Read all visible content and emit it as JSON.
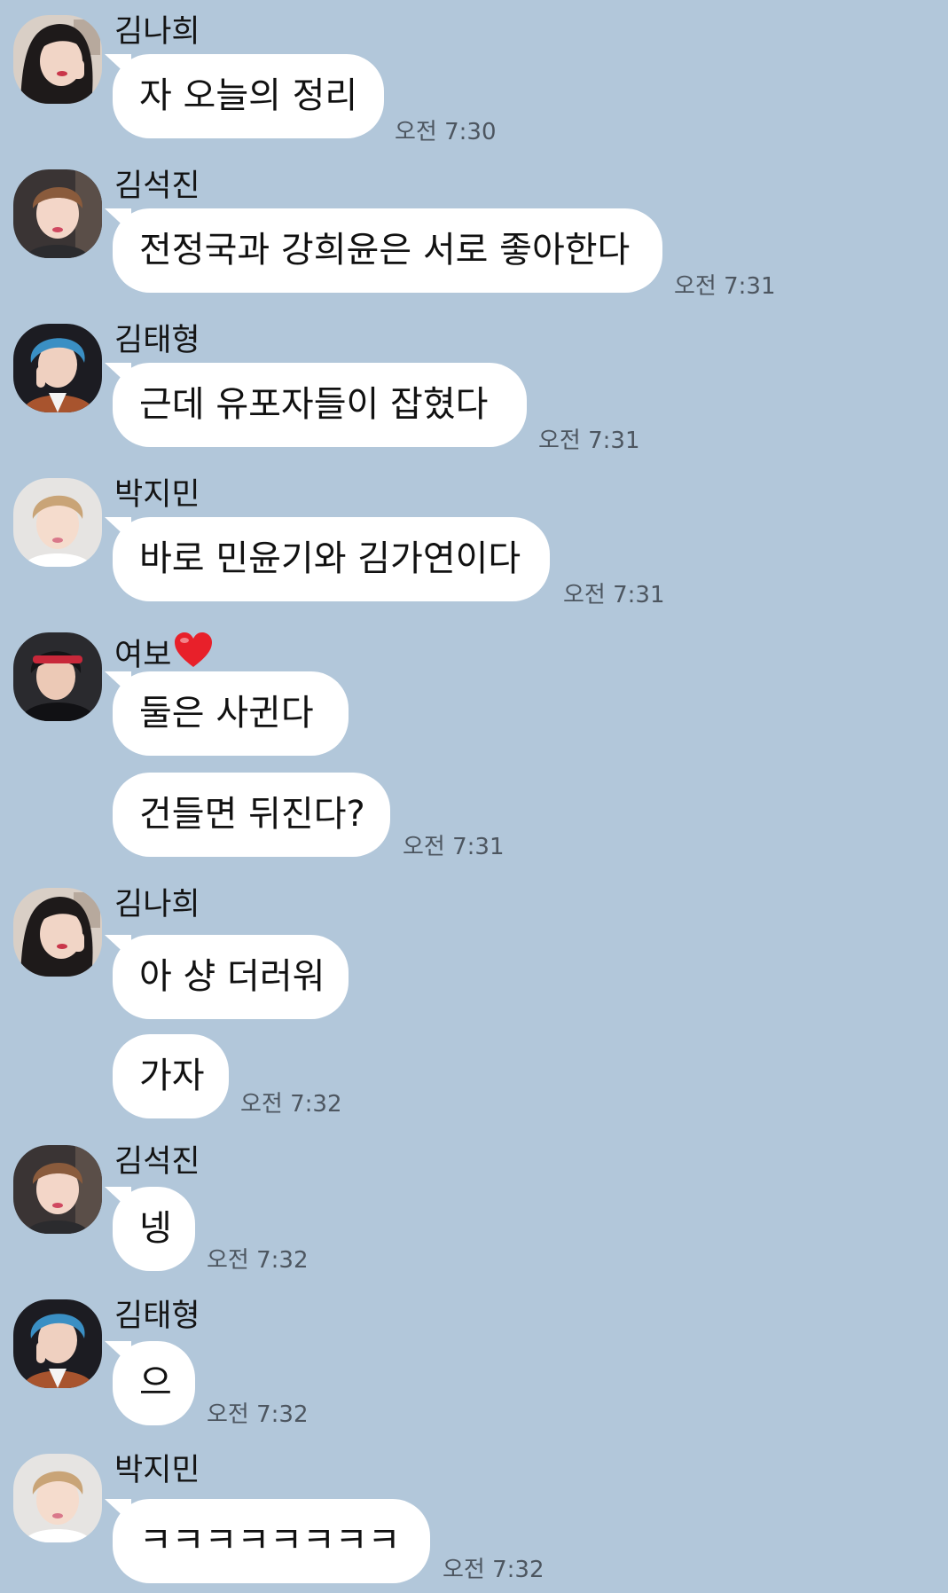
{
  "messages": [
    {
      "sender": "김나희",
      "avatar": "nahee-avatar",
      "heart": false,
      "bubbles": [
        {
          "text": "자 오늘의 정리"
        }
      ],
      "time": "오전 7:30"
    },
    {
      "sender": "김석진",
      "avatar": "seokjin-avatar",
      "heart": false,
      "bubbles": [
        {
          "text": "전정국과 강희윤은 서로 좋아한다"
        }
      ],
      "time": "오전 7:31"
    },
    {
      "sender": "김태형",
      "avatar": "taehyung-avatar",
      "heart": false,
      "bubbles": [
        {
          "text": "근데 유포자들이 잡혔다"
        }
      ],
      "time": "오전 7:31"
    },
    {
      "sender": "박지민",
      "avatar": "jimin-avatar",
      "heart": false,
      "bubbles": [
        {
          "text": "바로 민윤기와 김가연이다"
        }
      ],
      "time": "오전 7:31"
    },
    {
      "sender": "여보",
      "avatar": "jungkook-avatar",
      "heart": true,
      "bubbles": [
        {
          "text": "둘은 사귄다"
        },
        {
          "text": "건들면 뒤진다?"
        }
      ],
      "time": "오전 7:31"
    },
    {
      "sender": "김나희",
      "avatar": "nahee-avatar",
      "heart": false,
      "bubbles": [
        {
          "text": "아 샹 더러워"
        },
        {
          "text": "가자"
        }
      ],
      "time": "오전 7:32"
    },
    {
      "sender": "김석진",
      "avatar": "seokjin-avatar",
      "heart": false,
      "bubbles": [
        {
          "text": "넹"
        }
      ],
      "time": "오전 7:32"
    },
    {
      "sender": "김태형",
      "avatar": "taehyung-avatar",
      "heart": false,
      "bubbles": [
        {
          "text": "으"
        }
      ],
      "time": "오전 7:32"
    },
    {
      "sender": "박지민",
      "avatar": "jimin-avatar",
      "heart": false,
      "bubbles": [
        {
          "text": "ㅋㅋㅋㅋㅋㅋㅋㅋ"
        }
      ],
      "time": "오전 7:32"
    }
  ],
  "colors": {
    "background": "#b2c7da",
    "bubble": "#ffffff",
    "time_text": "#4d5660",
    "heart": "#e8202a"
  }
}
